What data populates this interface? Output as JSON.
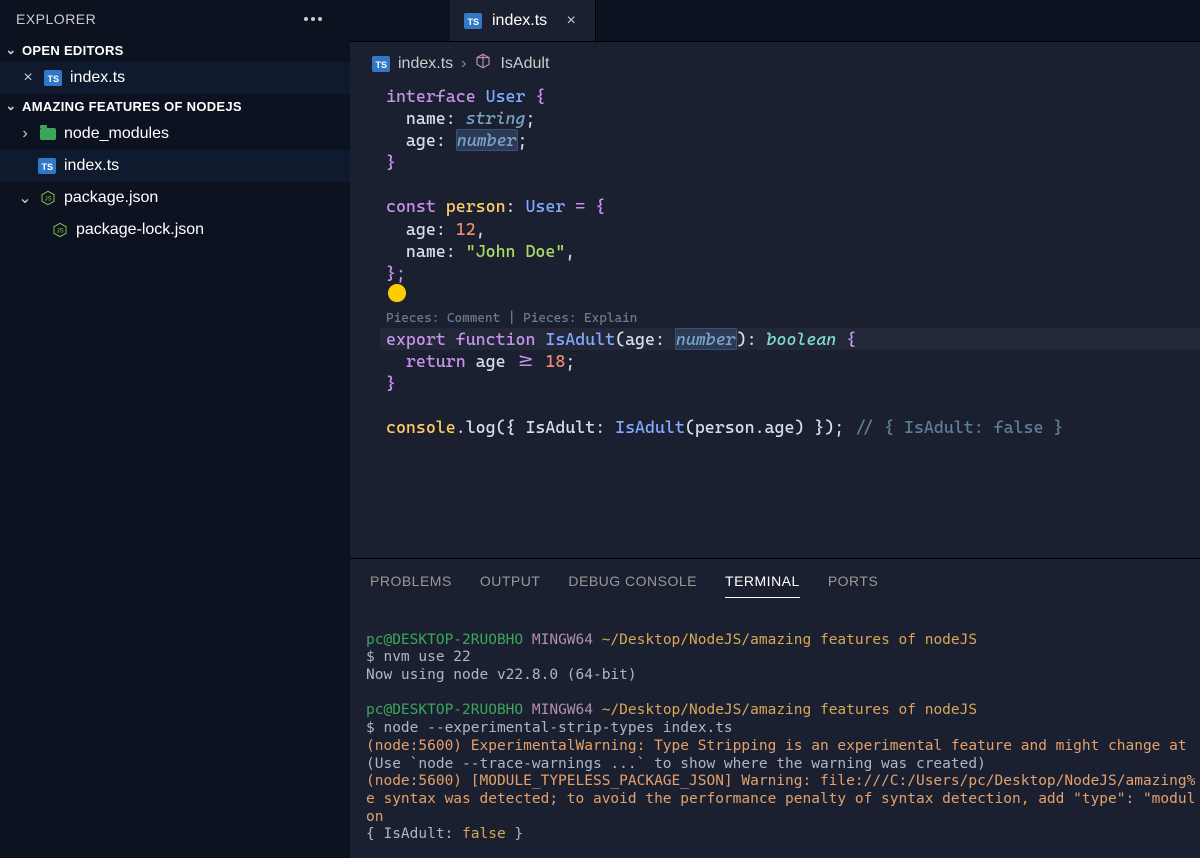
{
  "sidebar": {
    "title": "EXPLORER",
    "open_editors_label": "OPEN EDITORS",
    "open_editor_file": "index.ts",
    "workspace_label": "AMAZING FEATURES OF NODEJS",
    "items": [
      {
        "label": "node_modules"
      },
      {
        "label": "index.ts"
      },
      {
        "label": "package.json"
      },
      {
        "label": "package-lock.json"
      }
    ]
  },
  "tab": {
    "filename": "index.ts"
  },
  "breadcrumbs": {
    "file": "index.ts",
    "sep": "›",
    "symbol": "IsAdult"
  },
  "code": {
    "l1a": "interface",
    "l1b": " User",
    "l1c": " {",
    "l2a": "  name",
    "l2b": ": ",
    "l2c": "string",
    "l2d": ";",
    "l3a": "  age",
    "l3b": ": ",
    "l3c": "number",
    "l3d": ";",
    "l4": "}",
    "l6a": "const",
    "l6b": " person",
    "l6c": ": ",
    "l6d": "User",
    "l6e": " = {",
    "l7a": "  age",
    "l7b": ": ",
    "l7c": "12",
    "l7d": ",",
    "l8a": "  name",
    "l8b": ": ",
    "l8c": "\"John Doe\"",
    "l8d": ",",
    "l9": "};",
    "codelens": "Pieces: Comment | Pieces: Explain",
    "l11a": "export",
    "l11b": " function",
    "l11c": " IsAdult",
    "l11d": "(age",
    "l11e": ": ",
    "l11f": "number",
    "l11g": ")",
    "l11h": ": ",
    "l11i": "boolean",
    "l11j": " {",
    "l12a": "  return",
    "l12b": " age ",
    "l12c": ">=",
    "l12d": " ",
    "l12e": "18",
    "l12f": ";",
    "l13": "}",
    "l15a": "console",
    "l15b": ".log({ ",
    "l15c": "IsAdult",
    "l15d": ": ",
    "l15e": "IsAdult",
    "l15f": "(person",
    "l15g": ".age) }); ",
    "l15h": "// { IsAdult: false }"
  },
  "panel": {
    "tabs": {
      "problems": "PROBLEMS",
      "output": "OUTPUT",
      "debug": "DEBUG CONSOLE",
      "terminal": "TERMINAL",
      "ports": "PORTS"
    }
  },
  "terminal": {
    "p1_user": "pc@DESKTOP-2RUOBHO ",
    "p1_sys": "MINGW64 ",
    "p1_path": "~/Desktop/NodeJS/amazing features of nodeJS",
    "l1": "$ nvm use 22",
    "l2": "Now using node v22.8.0 (64-bit)",
    "p2_user": "pc@DESKTOP-2RUOBHO ",
    "p2_sys": "MINGW64 ",
    "p2_path": "~/Desktop/NodeJS/amazing features of nodeJS",
    "l3": "$ node --experimental-strip-types index.ts",
    "l4": "(node:5600) ExperimentalWarning: Type Stripping is an experimental feature and might change at",
    "l5": "(Use `node --trace-warnings ...` to show where the warning was created)",
    "l6": "(node:5600) [MODULE_TYPELESS_PACKAGE_JSON] Warning: file:///C:/Users/pc/Desktop/NodeJS/amazing%",
    "l7": "e syntax was detected; to avoid the performance penalty of syntax detection, add \"type\": \"modul",
    "l8": "on",
    "l9": "{ IsAdult: ",
    "l9b": "false",
    "l9c": " }"
  }
}
